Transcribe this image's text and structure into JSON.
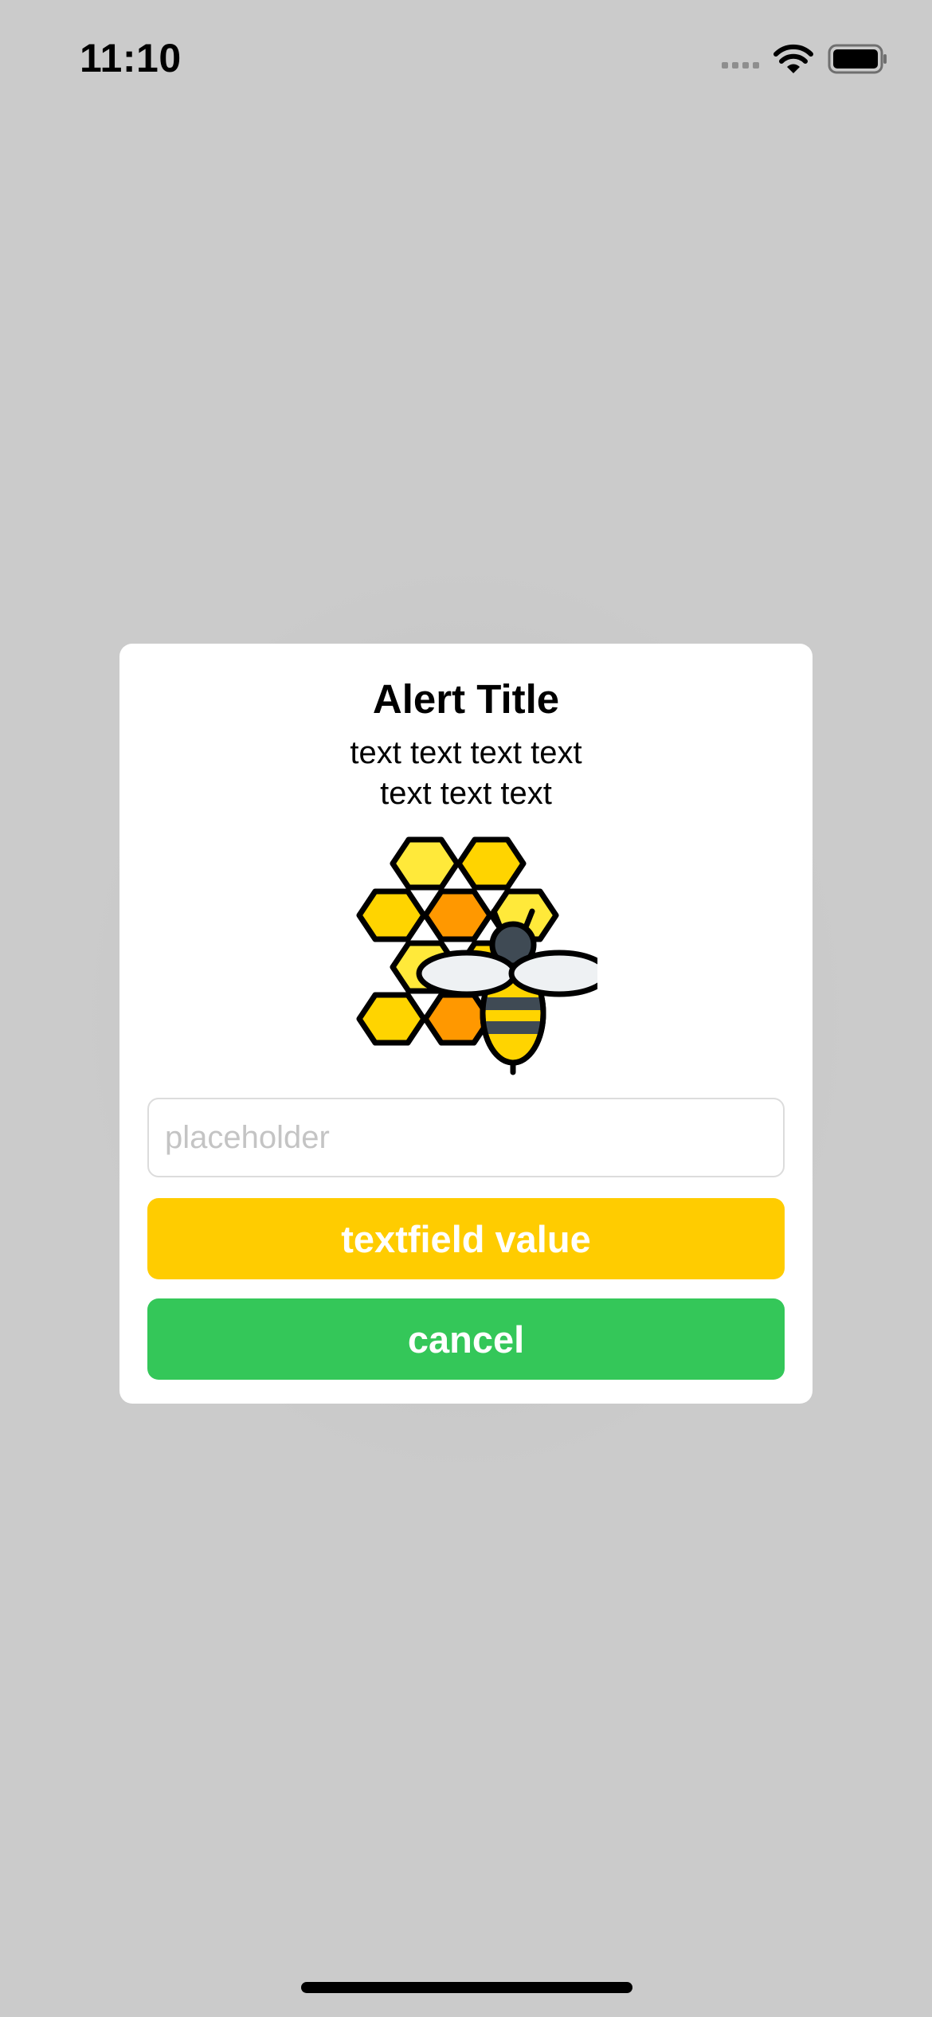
{
  "status_bar": {
    "time": "11:10",
    "icons": [
      "cellular-signal-icon",
      "wifi-icon",
      "battery-icon"
    ]
  },
  "alert": {
    "title": "Alert Title",
    "message_lines": [
      "text text text text",
      "text text text"
    ],
    "illustration": "honeycomb-bee-icon",
    "input": {
      "placeholder": "placeholder",
      "value": ""
    },
    "buttons": {
      "primary_label": "textfield value",
      "cancel_label": "cancel"
    }
  },
  "colors": {
    "backdrop": "#cbcbcb",
    "primary_button": "#ffcc00",
    "cancel_button": "#34c759",
    "placeholder_text": "#c4c4c4",
    "honey_light": "#ffe93a",
    "honey_dark": "#ff9500"
  }
}
